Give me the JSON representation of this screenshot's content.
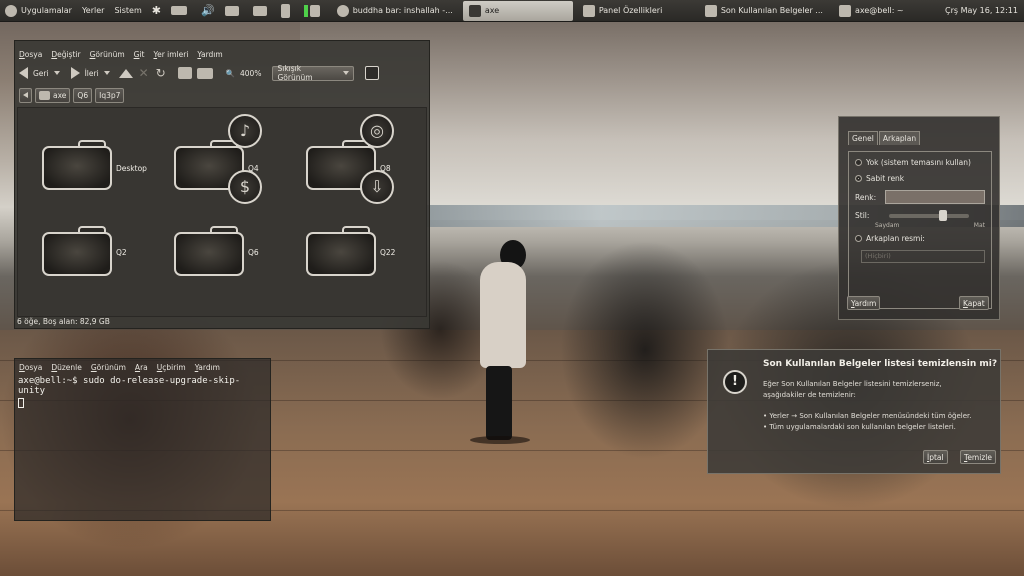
{
  "panel": {
    "applications": "Uygulamalar",
    "places": "Yerler",
    "system": "Sistem",
    "tasks": [
      {
        "label": "buddha bar: inshallah -...",
        "active": false
      },
      {
        "label": "axe",
        "active": true
      },
      {
        "label": "Panel Özellikleri",
        "active": false
      },
      {
        "label": "Son Kullanılan Belgeler ...",
        "active": false
      },
      {
        "label": "axe@bell: ~",
        "active": false
      }
    ],
    "clock": "Çrş May 16, 12:11"
  },
  "file_manager": {
    "menu": [
      "Dosya",
      "Değiştir",
      "Görünüm",
      "Git",
      "Yer imleri",
      "Yardım"
    ],
    "back_label": "Geri",
    "forward_label": "İleri",
    "zoom": "400%",
    "view_mode": "Sıkışık Görünüm",
    "path": [
      "axe",
      "Q6",
      "Iq3p7"
    ],
    "items": [
      {
        "name": "Desktop"
      },
      {
        "name": "Q4"
      },
      {
        "name": "Q8"
      },
      {
        "name": "Q2"
      },
      {
        "name": "Q6"
      },
      {
        "name": "Q22"
      }
    ],
    "status": "6 öğe, Boş alan: 82,9 GB"
  },
  "terminal": {
    "menu": [
      "Dosya",
      "Düzenle",
      "Görünüm",
      "Ara",
      "Uçbirim",
      "Yardım"
    ],
    "prompt_line": "axe@bell:~$ sudo do-release-upgrade-skip-unity"
  },
  "appearance": {
    "tabs": [
      "Genel",
      "Arkaplan"
    ],
    "option_none": "Yok (sistem temasını kullan)",
    "option_solid": "Sabit renk",
    "color_label": "Renk:",
    "style_label": "Stil:",
    "transparent": "Saydam",
    "opaque": "Mat",
    "bg_image": "Arkaplan resmi:",
    "file_placeholder": "(Hiçbiri)",
    "help_button": "Yardım",
    "close_button": "Kapat",
    "swatch_color": "#7a7068"
  },
  "confirm": {
    "title": "Son Kullanılan Belgeler listesi temizlensin mi?",
    "message": "Eğer Son Kullanılan Belgeler listesini temizlerseniz, aşağıdakiler de temizlenir:",
    "bullets": [
      "Yerler → Son Kullanılan Belgeler menüsündeki tüm öğeler.",
      "Tüm uygulamalardaki son kullanılan belgeler listeleri."
    ],
    "cancel_button": "İptal",
    "clear_button": "Temizle"
  }
}
